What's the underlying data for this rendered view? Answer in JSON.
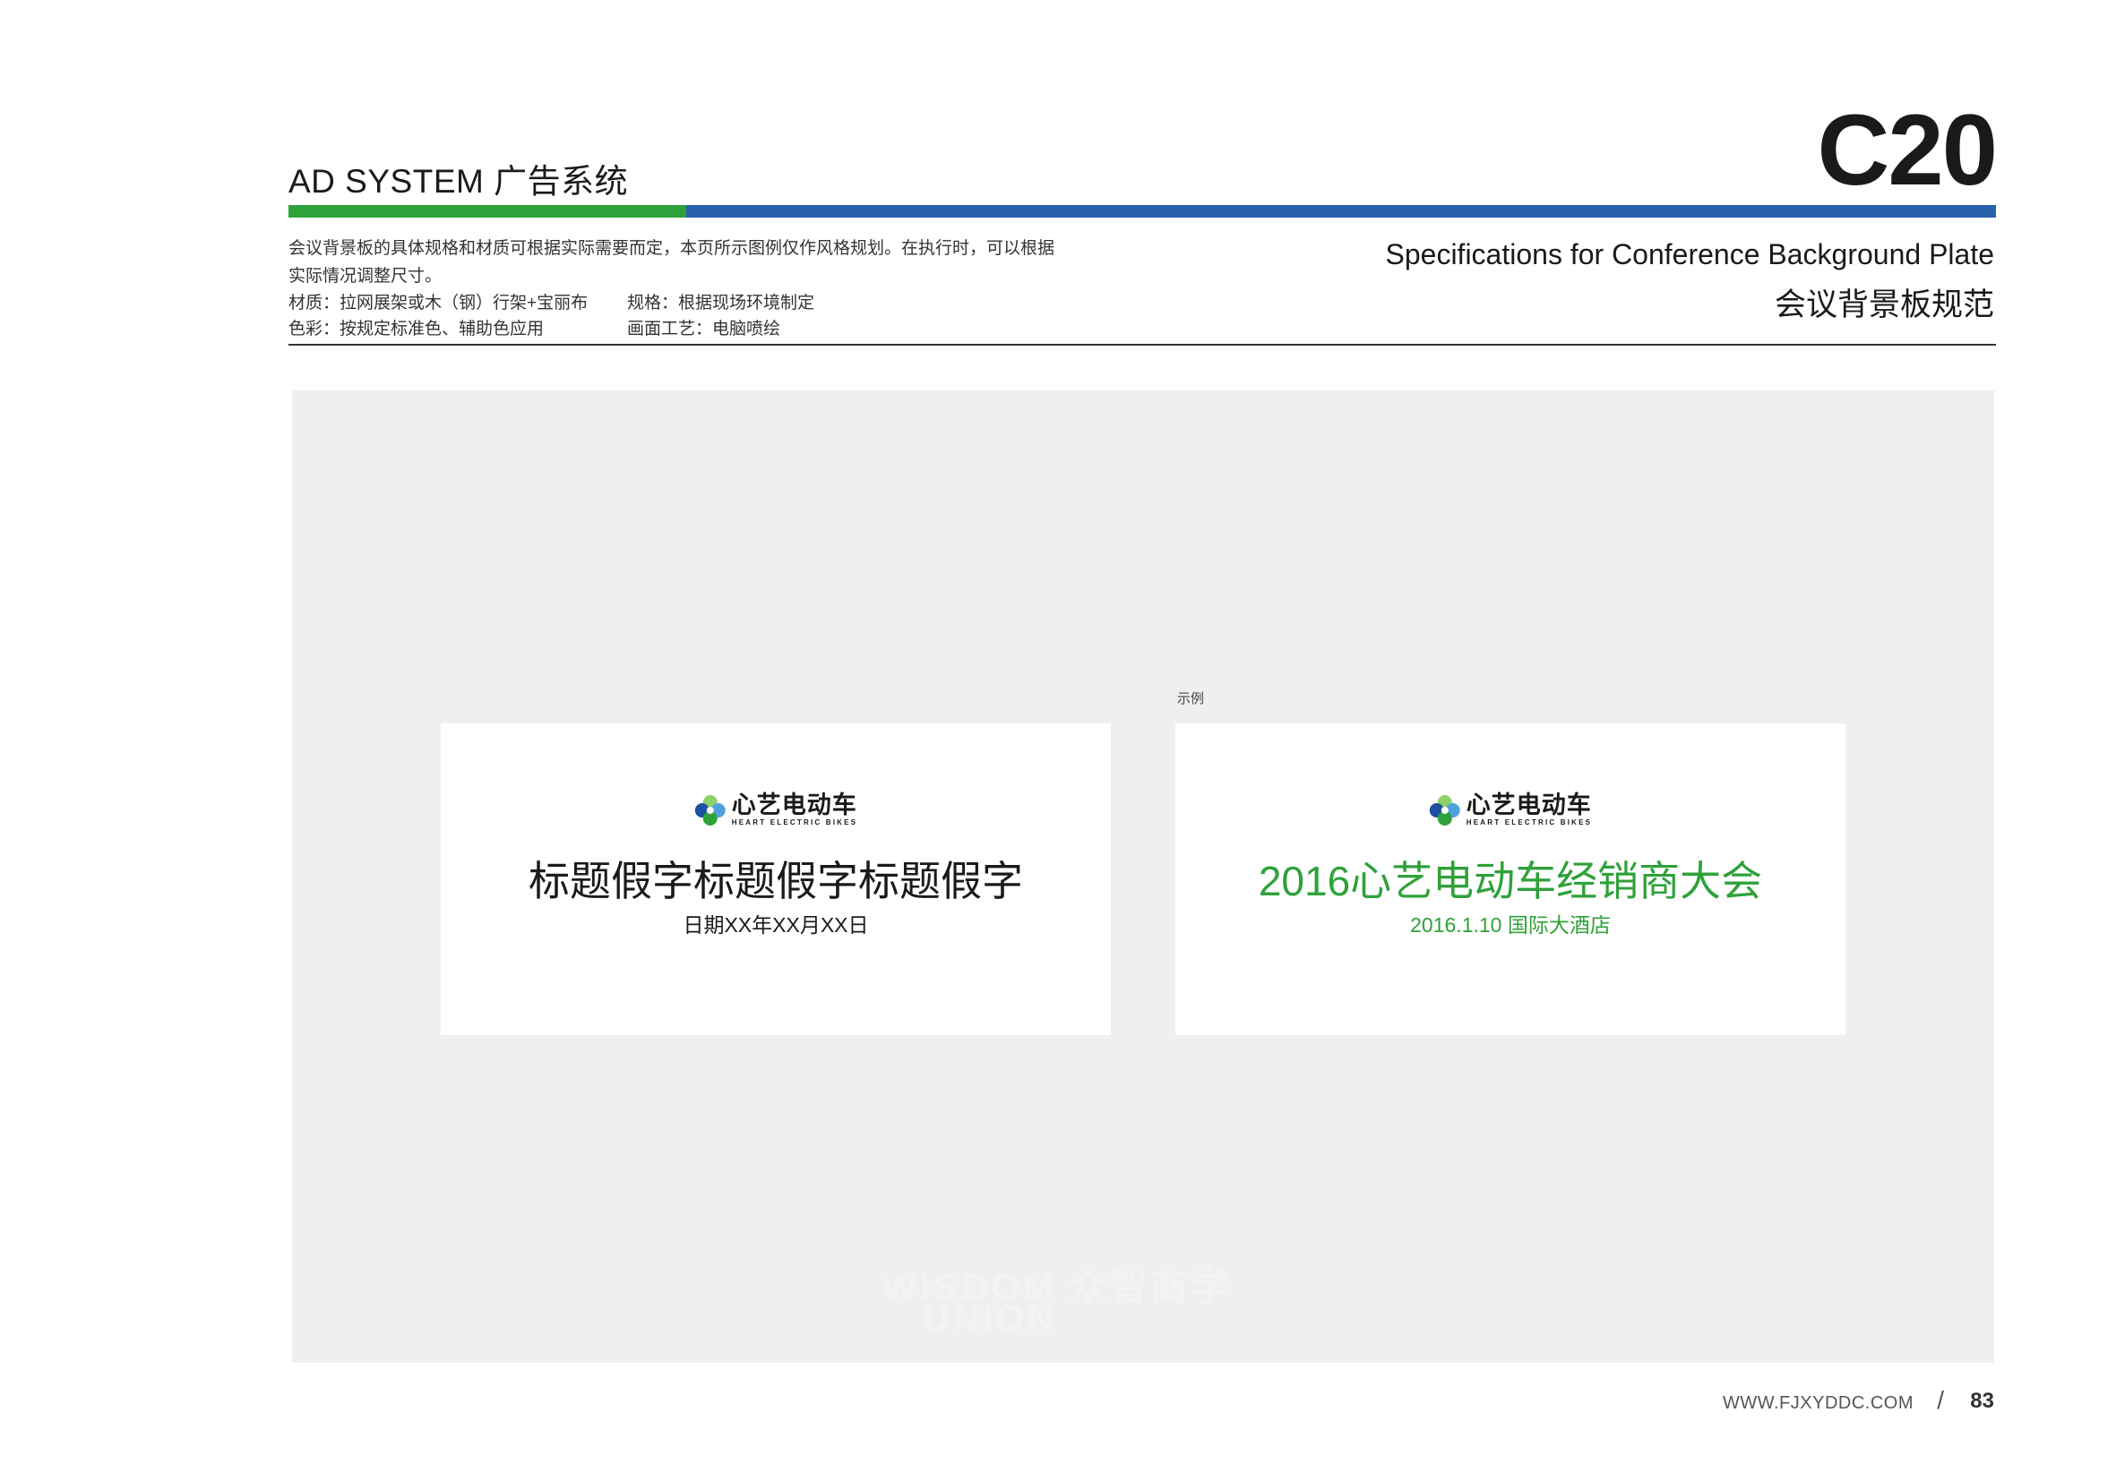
{
  "header": {
    "section_title": "AD SYSTEM 广告系统",
    "page_code": "C20",
    "spec_title_en": "Specifications for  Conference Background Plate",
    "spec_title_zh": "会议背景板规范"
  },
  "colors": {
    "brand_green": "#2fa13a",
    "brand_blue": "#2961ad",
    "canvas_gray": "#eef0ef"
  },
  "description": {
    "line1": "会议背景板的具体规格和材质可根据实际需要而定，本页所示图例仅作风格规划。在执行时，可以根据",
    "line2": "实际情况调整尺寸。",
    "material": "材质：拉网展架或木（钢）行架+宝丽布",
    "spec": "规格：根据现场环境制定",
    "color": "色彩：按规定标准色、辅助色应用",
    "craft": "画面工艺：电脑喷绘"
  },
  "example_label": "示例",
  "boards": {
    "template": {
      "logo_cn": "心艺电动车",
      "logo_en": "HEART ELECTRIC BIKES",
      "title": "标题假字标题假字标题假字",
      "subtitle": "日期XX年XX月XX日"
    },
    "example": {
      "logo_cn": "心艺电动车",
      "logo_en": "HEART ELECTRIC BIKES",
      "title": "2016心艺电动车经销商大会",
      "subtitle": "2016.1.10  国际大酒店"
    }
  },
  "watermark": {
    "line1": "WISDOM 众智商学",
    "line2": "UNION"
  },
  "footer": {
    "url": "WWW.FJXYDDC.COM",
    "slash": "/",
    "page_number": "83"
  }
}
